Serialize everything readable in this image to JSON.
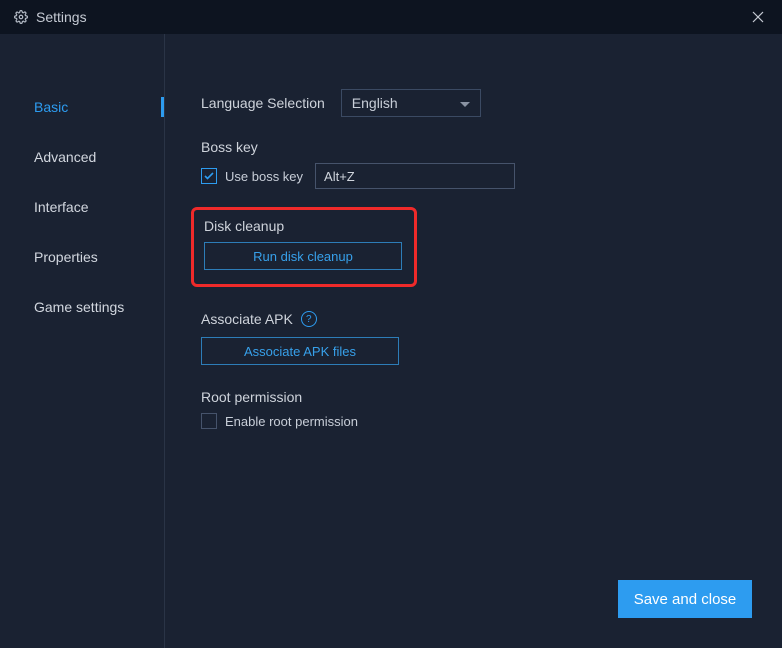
{
  "window": {
    "title": "Settings"
  },
  "sidebar": {
    "items": [
      {
        "label": "Basic",
        "active": true
      },
      {
        "label": "Advanced"
      },
      {
        "label": "Interface"
      },
      {
        "label": "Properties"
      },
      {
        "label": "Game settings"
      }
    ]
  },
  "main": {
    "language": {
      "label": "Language Selection",
      "value": "English"
    },
    "bosskey": {
      "label": "Boss key",
      "checkbox_label": "Use boss key",
      "checked": true,
      "hotkey": "Alt+Z"
    },
    "disk": {
      "label": "Disk cleanup",
      "button": "Run disk cleanup"
    },
    "apk": {
      "label": "Associate APK",
      "button": "Associate APK files"
    },
    "root": {
      "label": "Root permission",
      "checkbox_label": "Enable root permission",
      "checked": false
    }
  },
  "footer": {
    "save": "Save and close"
  }
}
